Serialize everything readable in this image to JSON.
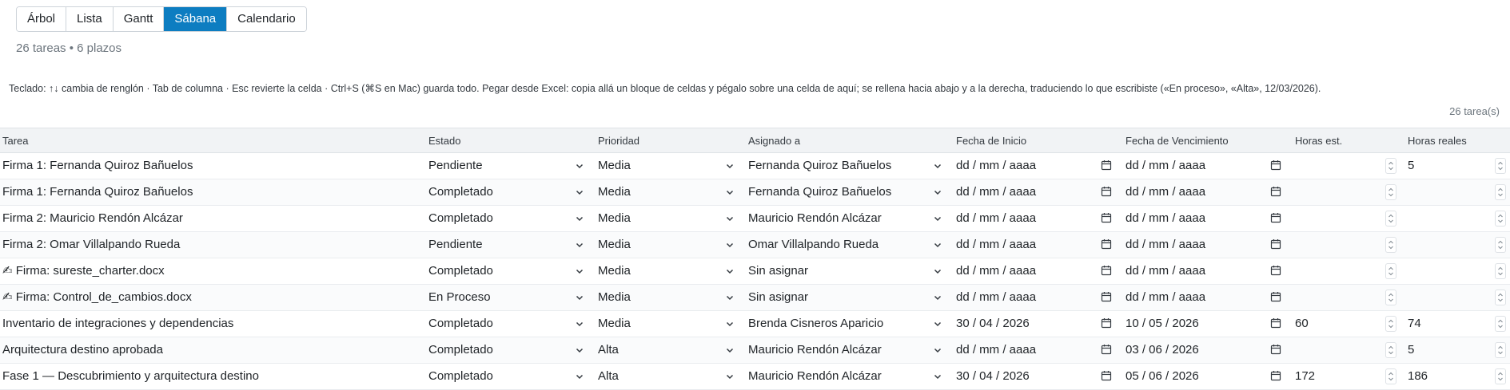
{
  "views": [
    {
      "label": "Árbol",
      "active": false
    },
    {
      "label": "Lista",
      "active": false
    },
    {
      "label": "Gantt",
      "active": false
    },
    {
      "label": "Sábana",
      "active": true
    },
    {
      "label": "Calendario",
      "active": false
    }
  ],
  "summary": "26 tareas • 6 plazos",
  "hint": "Teclado: ↑↓ cambia de renglón · Tab de columna · Esc revierte la celda · Ctrl+S (⌘S en Mac) guarda todo. Pegar desde Excel: copia allá un bloque de celdas y pégalo sobre una celda de aquí; se rellena hacia abajo y a la derecha, traduciendo lo que escribiste («En proceso», «Alta», 12/03/2026).",
  "count": "26 tarea(s)",
  "columns": {
    "task": "Tarea",
    "status": "Estado",
    "priority": "Prioridad",
    "assignee": "Asignado a",
    "start": "Fecha de Inicio",
    "due": "Fecha de Vencimiento",
    "est_hours": "Horas est.",
    "real_hours": "Horas reales"
  },
  "rows": [
    {
      "task": "Firma 1: Fernanda Quiroz Bañuelos",
      "status": "Pendiente",
      "priority": "Media",
      "assignee": "Fernanda Quiroz Bañuelos",
      "start": "dd / mm / aaaa",
      "due": "dd / mm / aaaa",
      "est_hours": "",
      "real_hours": "5"
    },
    {
      "task": "Firma 1: Fernanda Quiroz Bañuelos",
      "status": "Completado",
      "priority": "Media",
      "assignee": "Fernanda Quiroz Bañuelos",
      "start": "dd / mm / aaaa",
      "due": "dd / mm / aaaa",
      "est_hours": "",
      "real_hours": ""
    },
    {
      "task": "Firma 2: Mauricio Rendón Alcázar",
      "status": "Completado",
      "priority": "Media",
      "assignee": "Mauricio Rendón Alcázar",
      "start": "dd / mm / aaaa",
      "due": "dd / mm / aaaa",
      "est_hours": "",
      "real_hours": ""
    },
    {
      "task": "Firma 2: Omar Villalpando Rueda",
      "status": "Pendiente",
      "priority": "Media",
      "assignee": "Omar Villalpando Rueda",
      "start": "dd / mm / aaaa",
      "due": "dd / mm / aaaa",
      "est_hours": "",
      "real_hours": ""
    },
    {
      "task": "✍ Firma: sureste_charter.docx",
      "status": "Completado",
      "priority": "Media",
      "assignee": "Sin asignar",
      "start": "dd / mm / aaaa",
      "due": "dd / mm / aaaa",
      "est_hours": "",
      "real_hours": ""
    },
    {
      "task": "✍ Firma: Control_de_cambios.docx",
      "status": "En Proceso",
      "priority": "Media",
      "assignee": "Sin asignar",
      "start": "dd / mm / aaaa",
      "due": "dd / mm / aaaa",
      "est_hours": "",
      "real_hours": ""
    },
    {
      "task": "Inventario de integraciones y dependencias",
      "status": "Completado",
      "priority": "Media",
      "assignee": "Brenda Cisneros Aparicio",
      "start": "30 / 04 / 2026",
      "due": "10 / 05 / 2026",
      "est_hours": "60",
      "real_hours": "74"
    },
    {
      "task": "Arquitectura destino aprobada",
      "status": "Completado",
      "priority": "Alta",
      "assignee": "Mauricio Rendón Alcázar",
      "start": "dd / mm / aaaa",
      "due": "03 / 06 / 2026",
      "est_hours": "",
      "real_hours": "5"
    },
    {
      "task": "Fase 1 — Descubrimiento y arquitectura destino",
      "status": "Completado",
      "priority": "Alta",
      "assignee": "Mauricio Rendón Alcázar",
      "start": "30 / 04 / 2026",
      "due": "05 / 06 / 2026",
      "est_hours": "172",
      "real_hours": "186"
    }
  ],
  "icons": {
    "dropdown": "chevron-down-icon",
    "date": "calendar-icon",
    "spinner": "spinner-updown-icon"
  },
  "colors": {
    "accent": "#0d7dc1",
    "header_bg": "#f1f3f5",
    "border": "#dee2e6",
    "muted": "#6c757d"
  }
}
